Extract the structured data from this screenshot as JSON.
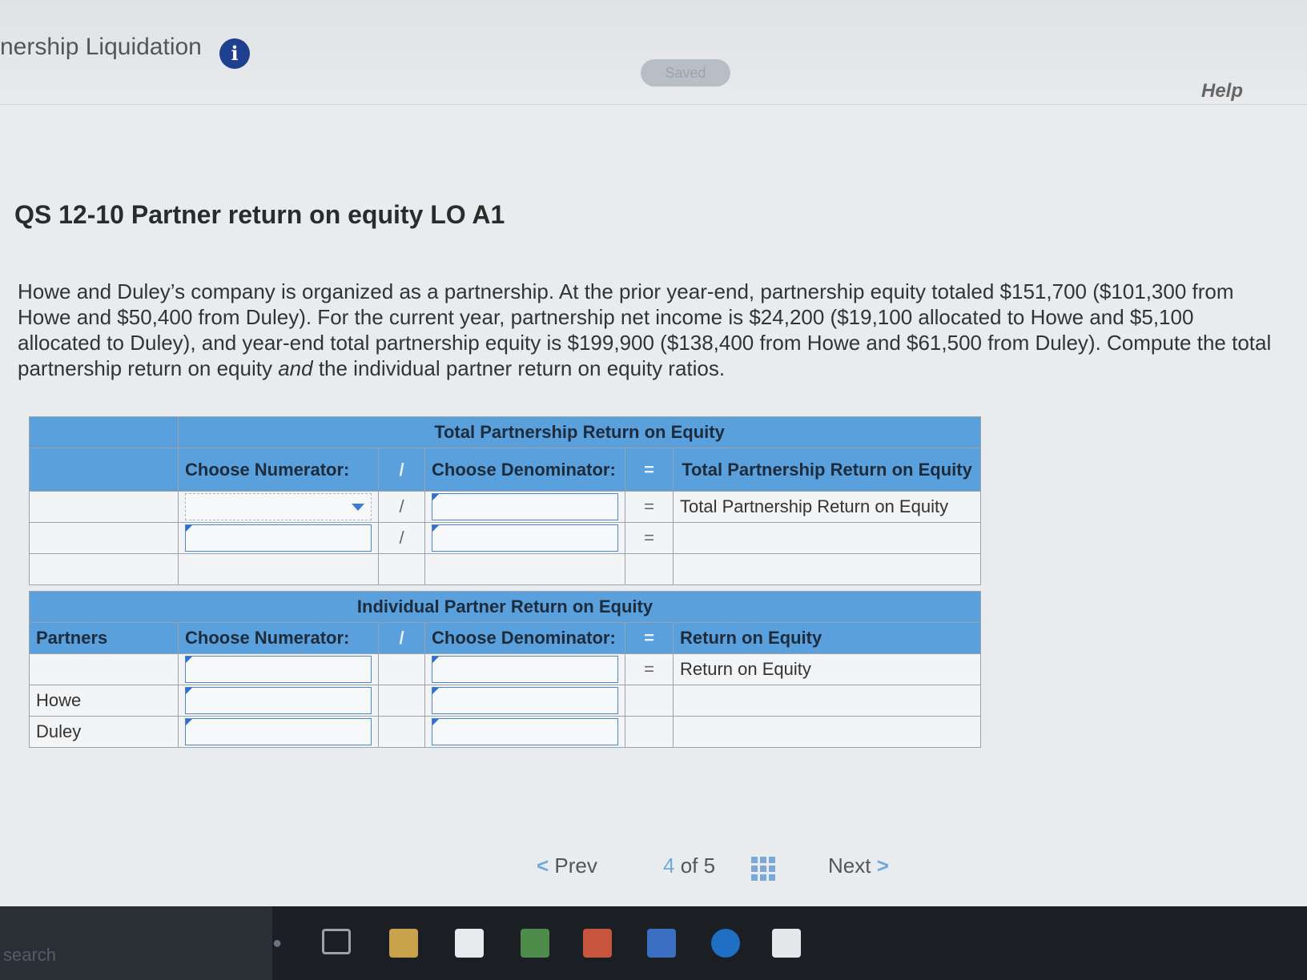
{
  "header": {
    "app_title": "nership Liquidation",
    "saved_label": "Saved",
    "help_label": "Help"
  },
  "question": {
    "title": "QS 12-10 Partner return on equity LO A1",
    "text_before": "Howe and Duley’s company is organized as a partnership. At the prior year-end, partnership equity totaled $151,700 ($101,300 from Howe and $50,400 from Duley). For the current year, partnership net income is $24,200 ($19,100 allocated to Howe and $5,100 allocated to Duley), and year-end total partnership equity is $199,900 ($138,400 from Howe and $61,500 from Duley). Compute the total partnership return on equity ",
    "text_emph": "and",
    "text_after": " the individual partner return on equity ratios."
  },
  "total_table": {
    "title": "Total Partnership Return on Equity",
    "numerator_header": "Choose Numerator:",
    "divide": "/",
    "denominator_header": "Choose Denominator:",
    "equals": "=",
    "result_header": "Total Partnership Return on Equity",
    "result_row_label": "Total Partnership Return on Equity"
  },
  "partner_table": {
    "title": "Individual Partner Return on Equity",
    "partners_header": "Partners",
    "numerator_header": "Choose Numerator:",
    "divide": "/",
    "denominator_header": "Choose Denominator:",
    "equals": "=",
    "result_header": "Return on Equity",
    "result_row_label": "Return on Equity",
    "partners": [
      "Howe",
      "Duley"
    ]
  },
  "pagination": {
    "prev_label": "Prev",
    "current": "4",
    "of_label": "of",
    "total": "5",
    "next_label": "Next"
  },
  "taskbar": {
    "search_label": "search"
  },
  "colors": {
    "header_blue": "#5aa0dc",
    "input_border": "#4a86d8",
    "info_icon": "#1f3f8f",
    "taskbar": "#1b1f24"
  }
}
